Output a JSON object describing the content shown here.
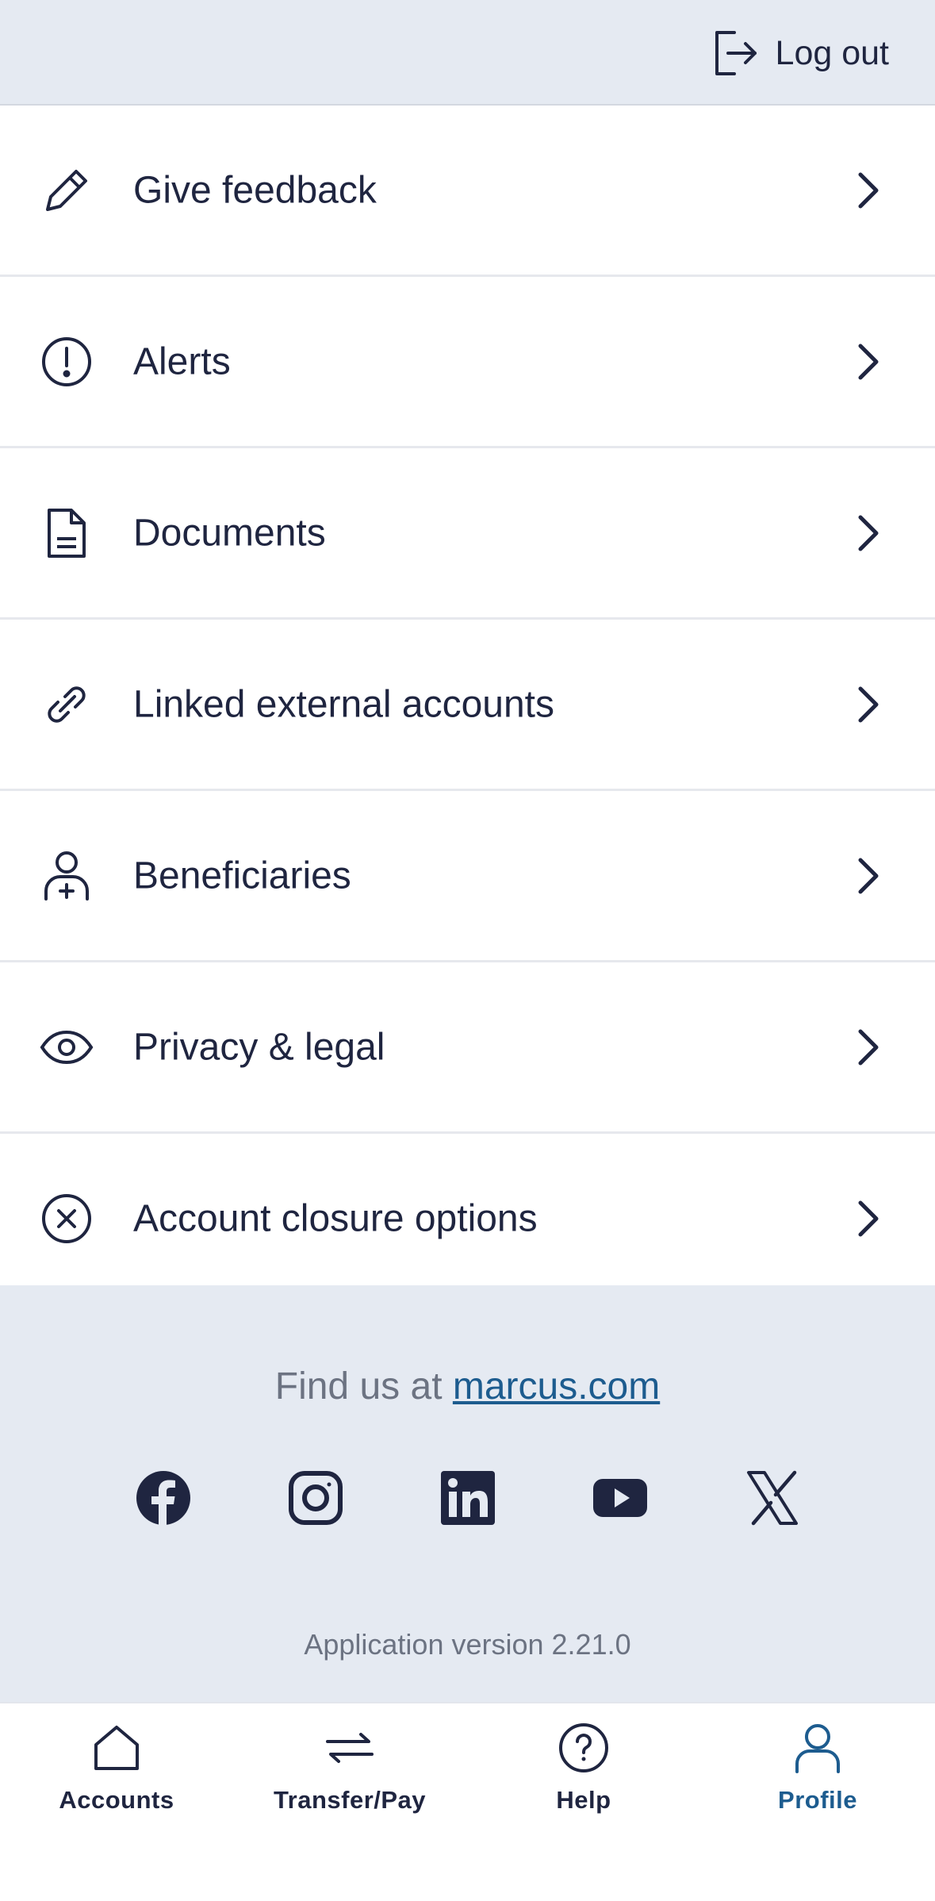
{
  "header": {
    "logout_label": "Log out",
    "logout_icon": "logout-icon"
  },
  "menu": {
    "items": [
      {
        "label": "Give feedback",
        "icon": "pencil-icon"
      },
      {
        "label": "Alerts",
        "icon": "alert-icon"
      },
      {
        "label": "Documents",
        "icon": "document-icon"
      },
      {
        "label": "Linked external accounts",
        "icon": "link-icon"
      },
      {
        "label": "Beneficiaries",
        "icon": "user-add-icon"
      },
      {
        "label": "Privacy & legal",
        "icon": "eye-icon"
      },
      {
        "label": "Account closure options",
        "icon": "close-circle-icon"
      }
    ]
  },
  "footer": {
    "find_prefix": "Find us at ",
    "find_link": "marcus.com",
    "socials": [
      "facebook-icon",
      "instagram-icon",
      "linkedin-icon",
      "youtube-icon",
      "x-icon"
    ],
    "version": "Application version 2.21.0"
  },
  "tabbar": {
    "tabs": [
      {
        "label": "Accounts",
        "icon": "home-icon",
        "active": false
      },
      {
        "label": "Transfer/Pay",
        "icon": "transfer-icon",
        "active": false
      },
      {
        "label": "Help",
        "icon": "help-icon",
        "active": false
      },
      {
        "label": "Profile",
        "icon": "profile-icon",
        "active": true
      }
    ]
  },
  "colors": {
    "text": "#1f2540",
    "muted": "#6c7382",
    "accent": "#1d5c8f",
    "footer_bg": "#e5eaf2"
  }
}
